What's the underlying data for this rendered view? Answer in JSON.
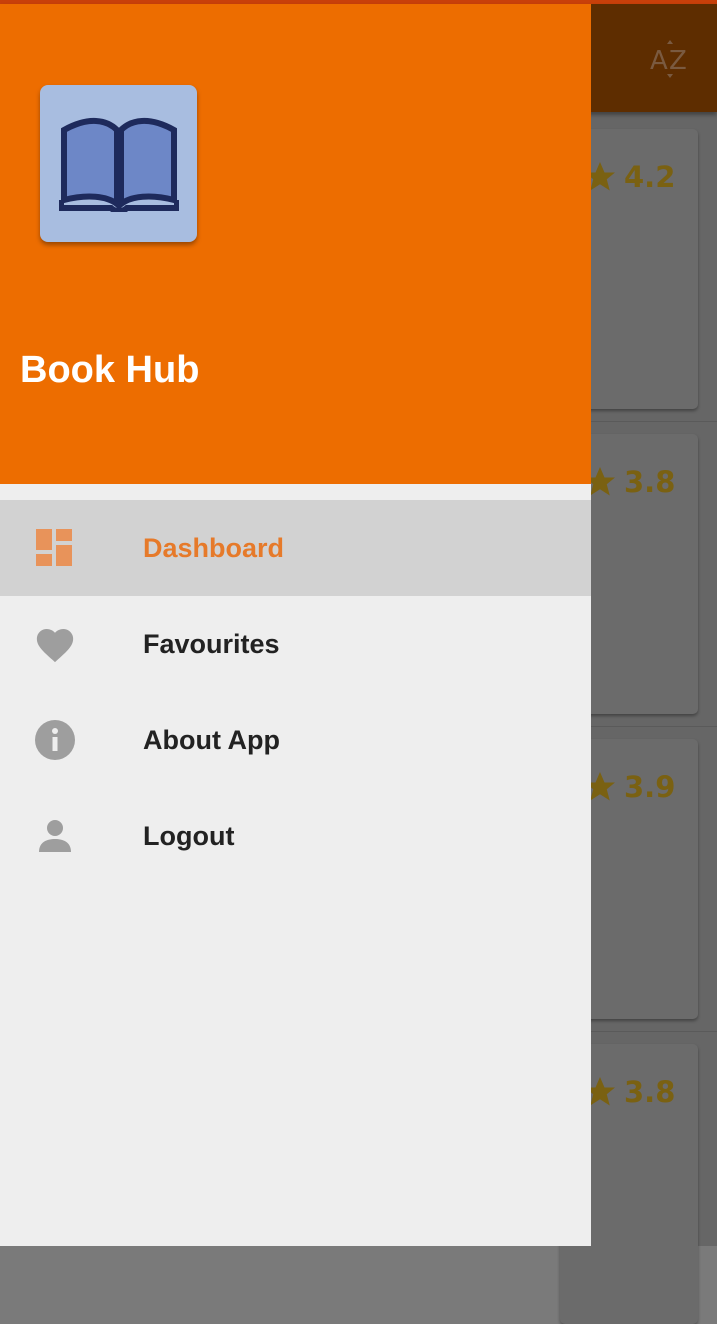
{
  "app": {
    "name": "Book Hub"
  },
  "toolbar": {
    "sort_icon": "sort-alpha-icon",
    "sort_glyph": "AZ"
  },
  "books": [
    {
      "rating": "4.2"
    },
    {
      "rating": "3.8"
    },
    {
      "rating": "3.9"
    },
    {
      "rating": "3.8"
    }
  ],
  "menu": {
    "items": [
      {
        "label": "Dashboard",
        "icon": "dashboard-icon",
        "active": true
      },
      {
        "label": "Favourites",
        "icon": "heart-icon",
        "active": false
      },
      {
        "label": "About App",
        "icon": "info-icon",
        "active": false
      },
      {
        "label": "Logout",
        "icon": "person-icon",
        "active": false
      }
    ]
  },
  "colors": {
    "header": "#ed6d00",
    "active_label": "#e67a2a",
    "logo_tile": "#a8bde0",
    "icon_gray": "#9e9e9e"
  }
}
